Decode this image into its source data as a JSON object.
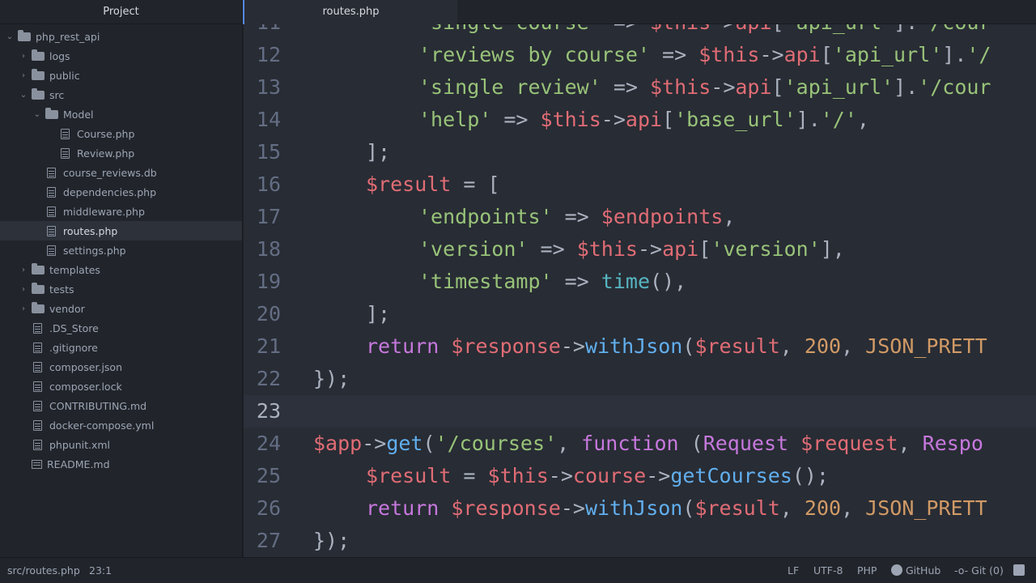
{
  "sidebar": {
    "title": "Project",
    "tree": [
      {
        "label": "php_rest_api",
        "type": "folder",
        "open": true,
        "depth": 0
      },
      {
        "label": "logs",
        "type": "folder",
        "open": false,
        "depth": 1
      },
      {
        "label": "public",
        "type": "folder",
        "open": false,
        "depth": 1
      },
      {
        "label": "src",
        "type": "folder",
        "open": true,
        "depth": 1
      },
      {
        "label": "Model",
        "type": "folder",
        "open": true,
        "depth": 2
      },
      {
        "label": "Course.php",
        "type": "file",
        "depth": 3
      },
      {
        "label": "Review.php",
        "type": "file",
        "depth": 3
      },
      {
        "label": "course_reviews.db",
        "type": "file",
        "depth": 2
      },
      {
        "label": "dependencies.php",
        "type": "file",
        "depth": 2
      },
      {
        "label": "middleware.php",
        "type": "file",
        "depth": 2
      },
      {
        "label": "routes.php",
        "type": "file",
        "depth": 2,
        "selected": true
      },
      {
        "label": "settings.php",
        "type": "file",
        "depth": 2
      },
      {
        "label": "templates",
        "type": "folder",
        "open": false,
        "depth": 1
      },
      {
        "label": "tests",
        "type": "folder",
        "open": false,
        "depth": 1
      },
      {
        "label": "vendor",
        "type": "folder",
        "open": false,
        "depth": 1
      },
      {
        "label": ".DS_Store",
        "type": "file",
        "depth": 1
      },
      {
        "label": ".gitignore",
        "type": "file",
        "depth": 1
      },
      {
        "label": "composer.json",
        "type": "file",
        "depth": 1
      },
      {
        "label": "composer.lock",
        "type": "file",
        "depth": 1
      },
      {
        "label": "CONTRIBUTING.md",
        "type": "file",
        "depth": 1
      },
      {
        "label": "docker-compose.yml",
        "type": "file",
        "depth": 1
      },
      {
        "label": "phpunit.xml",
        "type": "file",
        "depth": 1
      },
      {
        "label": "README.md",
        "type": "book",
        "depth": 1
      }
    ]
  },
  "tabs": [
    {
      "label": "routes.php",
      "active": true
    }
  ],
  "editor": {
    "cursor_line": 23,
    "lines": [
      {
        "n": "11",
        "indent": 2,
        "tokens": [
          [
            "'single course'",
            "str"
          ],
          [
            " => ",
            "pun"
          ],
          [
            "$this",
            "var"
          ],
          [
            "->",
            "pun"
          ],
          [
            "api",
            "var"
          ],
          [
            "[",
            "pun"
          ],
          [
            "'api_url'",
            "str"
          ],
          [
            "].",
            "pun"
          ],
          [
            "'/cour",
            "str"
          ]
        ]
      },
      {
        "n": "12",
        "indent": 2,
        "tokens": [
          [
            "'reviews by course'",
            "str"
          ],
          [
            " => ",
            "pun"
          ],
          [
            "$this",
            "var"
          ],
          [
            "->",
            "pun"
          ],
          [
            "api",
            "var"
          ],
          [
            "[",
            "pun"
          ],
          [
            "'api_url'",
            "str"
          ],
          [
            "].",
            "pun"
          ],
          [
            "'/",
            "str"
          ]
        ]
      },
      {
        "n": "13",
        "indent": 2,
        "tokens": [
          [
            "'single review'",
            "str"
          ],
          [
            " => ",
            "pun"
          ],
          [
            "$this",
            "var"
          ],
          [
            "->",
            "pun"
          ],
          [
            "api",
            "var"
          ],
          [
            "[",
            "pun"
          ],
          [
            "'api_url'",
            "str"
          ],
          [
            "].",
            "pun"
          ],
          [
            "'/cour",
            "str"
          ]
        ]
      },
      {
        "n": "14",
        "indent": 2,
        "tokens": [
          [
            "'help'",
            "str"
          ],
          [
            " => ",
            "pun"
          ],
          [
            "$this",
            "var"
          ],
          [
            "->",
            "pun"
          ],
          [
            "api",
            "var"
          ],
          [
            "[",
            "pun"
          ],
          [
            "'base_url'",
            "str"
          ],
          [
            "].",
            "pun"
          ],
          [
            "'/'",
            "str"
          ],
          [
            ",",
            "pun"
          ]
        ]
      },
      {
        "n": "15",
        "indent": 1,
        "tokens": [
          [
            "];",
            "pun"
          ]
        ]
      },
      {
        "n": "16",
        "indent": 1,
        "tokens": [
          [
            "$result",
            "var"
          ],
          [
            " = [",
            "pun"
          ]
        ]
      },
      {
        "n": "17",
        "indent": 2,
        "tokens": [
          [
            "'endpoints'",
            "str"
          ],
          [
            " => ",
            "pun"
          ],
          [
            "$endpoints",
            "var"
          ],
          [
            ",",
            "pun"
          ]
        ]
      },
      {
        "n": "18",
        "indent": 2,
        "tokens": [
          [
            "'version'",
            "str"
          ],
          [
            " => ",
            "pun"
          ],
          [
            "$this",
            "var"
          ],
          [
            "->",
            "pun"
          ],
          [
            "api",
            "var"
          ],
          [
            "[",
            "pun"
          ],
          [
            "'version'",
            "str"
          ],
          [
            "],",
            "pun"
          ]
        ]
      },
      {
        "n": "19",
        "indent": 2,
        "tokens": [
          [
            "'timestamp'",
            "str"
          ],
          [
            " => ",
            "pun"
          ],
          [
            "time",
            "builtin"
          ],
          [
            "(),",
            "pun"
          ]
        ]
      },
      {
        "n": "20",
        "indent": 1,
        "tokens": [
          [
            "];",
            "pun"
          ]
        ]
      },
      {
        "n": "21",
        "indent": 1,
        "tokens": [
          [
            "return",
            "kw"
          ],
          [
            " ",
            "pun"
          ],
          [
            "$response",
            "var"
          ],
          [
            "->",
            "pun"
          ],
          [
            "withJson",
            "fn"
          ],
          [
            "(",
            "pun"
          ],
          [
            "$result",
            "var"
          ],
          [
            ", ",
            "pun"
          ],
          [
            "200",
            "num"
          ],
          [
            ", ",
            "pun"
          ],
          [
            "JSON_PRETT",
            "const"
          ]
        ]
      },
      {
        "n": "22",
        "indent": 0,
        "tokens": [
          [
            "});",
            "pun"
          ]
        ]
      },
      {
        "n": "23",
        "indent": 0,
        "tokens": []
      },
      {
        "n": "24",
        "indent": 0,
        "tokens": [
          [
            "$app",
            "var"
          ],
          [
            "->",
            "pun"
          ],
          [
            "get",
            "fn"
          ],
          [
            "(",
            "pun"
          ],
          [
            "'/courses'",
            "str"
          ],
          [
            ", ",
            "pun"
          ],
          [
            "function",
            "kw"
          ],
          [
            " (",
            "pun"
          ],
          [
            "Request",
            "cls"
          ],
          [
            " ",
            "pun"
          ],
          [
            "$request",
            "var"
          ],
          [
            ", ",
            "pun"
          ],
          [
            "Respo",
            "cls"
          ]
        ]
      },
      {
        "n": "25",
        "indent": 1,
        "tokens": [
          [
            "$result",
            "var"
          ],
          [
            " = ",
            "pun"
          ],
          [
            "$this",
            "var"
          ],
          [
            "->",
            "pun"
          ],
          [
            "course",
            "var"
          ],
          [
            "->",
            "pun"
          ],
          [
            "getCourses",
            "fn"
          ],
          [
            "();",
            "pun"
          ]
        ]
      },
      {
        "n": "26",
        "indent": 1,
        "tokens": [
          [
            "return",
            "kw"
          ],
          [
            " ",
            "pun"
          ],
          [
            "$response",
            "var"
          ],
          [
            "->",
            "pun"
          ],
          [
            "withJson",
            "fn"
          ],
          [
            "(",
            "pun"
          ],
          [
            "$result",
            "var"
          ],
          [
            ", ",
            "pun"
          ],
          [
            "200",
            "num"
          ],
          [
            ", ",
            "pun"
          ],
          [
            "JSON_PRETT",
            "const"
          ]
        ]
      },
      {
        "n": "27",
        "indent": 0,
        "tokens": [
          [
            "});",
            "pun"
          ]
        ]
      }
    ]
  },
  "status": {
    "file_path": "src/routes.php",
    "cursor_pos": "23:1",
    "line_ending": "LF",
    "encoding": "UTF-8",
    "grammar": "PHP",
    "github_label": "GitHub",
    "git_label": "Git (0)"
  }
}
